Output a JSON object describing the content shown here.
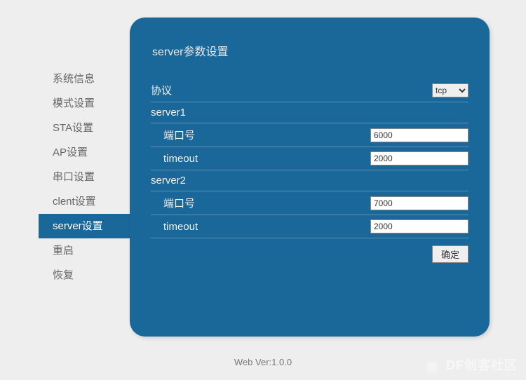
{
  "sidebar": {
    "items": [
      {
        "label": "系统信息"
      },
      {
        "label": "模式设置"
      },
      {
        "label": "STA设置"
      },
      {
        "label": "AP设置"
      },
      {
        "label": "串口设置"
      },
      {
        "label": "clent设置"
      },
      {
        "label": "server设置"
      },
      {
        "label": "重启"
      },
      {
        "label": "恢复"
      }
    ],
    "active_index": 6
  },
  "panel": {
    "title": "server参数设置",
    "protocol": {
      "label": "协议",
      "value": "tcp"
    },
    "server1": {
      "heading": "server1",
      "port": {
        "label": "端口号",
        "value": "6000"
      },
      "timeout": {
        "label": "timeout",
        "value": "2000"
      }
    },
    "server2": {
      "heading": "server2",
      "port": {
        "label": "端口号",
        "value": "7000"
      },
      "timeout": {
        "label": "timeout",
        "value": "2000"
      }
    },
    "submit_label": "确定"
  },
  "footer": {
    "version": "Web Ver:1.0.0"
  },
  "watermark": {
    "text": "DF创客社区"
  }
}
